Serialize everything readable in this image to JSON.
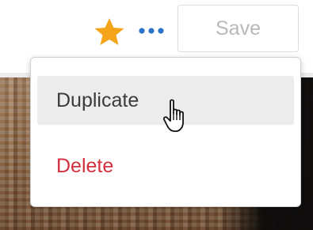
{
  "toolbar": {
    "star_icon": "star-icon",
    "more_icon": "more-options-icon",
    "save_label": "Save"
  },
  "menu": {
    "items": [
      {
        "label": "Duplicate",
        "state": "hovered"
      },
      {
        "label": "Delete",
        "color": "#d32f3c"
      }
    ]
  },
  "colors": {
    "star": "#f5a51c",
    "more_dots": "#2a73c9",
    "delete": "#d32f3c",
    "save_disabled_text": "#b9b9b9"
  },
  "cursor": "pointer-hand-icon"
}
